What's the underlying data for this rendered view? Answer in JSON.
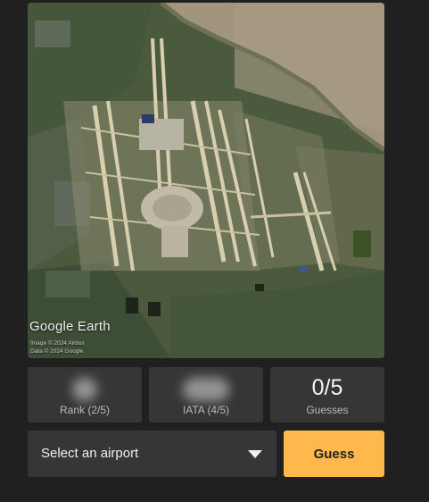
{
  "map": {
    "brand": "Google Earth",
    "attribution_line1": "Image © 2024 Airbus",
    "attribution_line2": "Data © 2024 Google"
  },
  "stats": {
    "rank": {
      "label": "Rank (2/5)"
    },
    "iata": {
      "label": "IATA (4/5)"
    },
    "guesses": {
      "value": "0/5",
      "label": "Guesses"
    }
  },
  "controls": {
    "select_placeholder": "Select an airport",
    "guess_label": "Guess"
  },
  "colors": {
    "background": "#202020",
    "panel": "#363636",
    "accent": "#ffb84c"
  }
}
